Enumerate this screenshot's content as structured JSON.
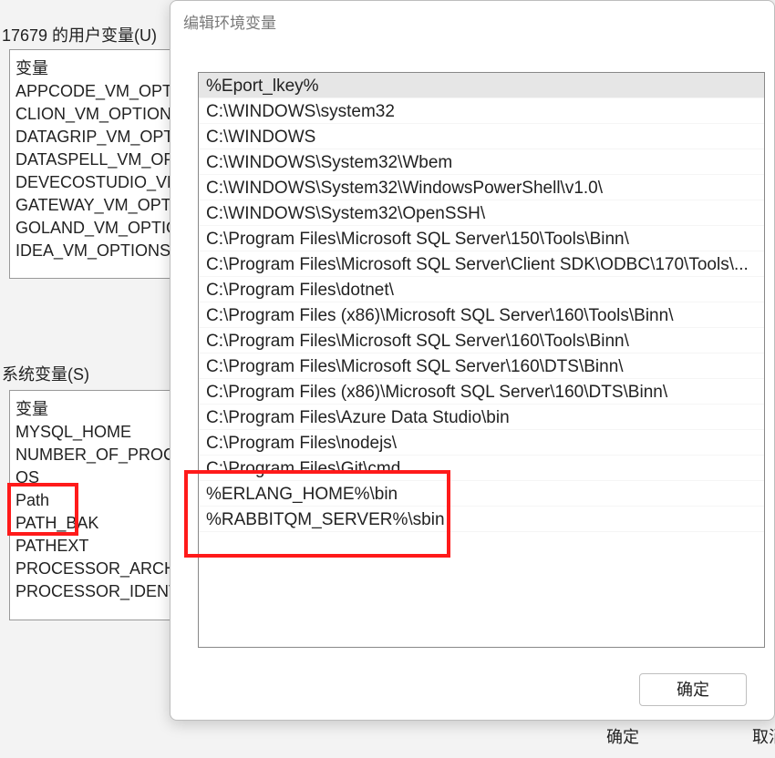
{
  "parent": {
    "user_vars_group_label": "17679 的用户变量(U)",
    "user_vars_header": "变量",
    "user_vars": [
      "APPCODE_VM_OPTIONS",
      "CLION_VM_OPTIONS",
      "DATAGRIP_VM_OPTIONS",
      "DATASPELL_VM_OPTIONS",
      "DEVECOSTUDIO_VM_OPTIONS",
      "GATEWAY_VM_OPTIONS",
      "GOLAND_VM_OPTIONS",
      "IDEA_VM_OPTIONS"
    ],
    "sys_vars_group_label": "系统变量(S)",
    "sys_vars_header": "变量",
    "sys_vars": [
      "MYSQL_HOME",
      "NUMBER_OF_PROCESSORS",
      "OS",
      "Path",
      "PATH_BAK",
      "PATHEXT",
      "PROCESSOR_ARCHITECTURE",
      "PROCESSOR_IDENTIFIER"
    ],
    "ok_label": "确定",
    "cancel_label": "取消"
  },
  "dialog": {
    "title": "编辑环境变量",
    "entries": [
      "%Eport_lkey%",
      "C:\\WINDOWS\\system32",
      "C:\\WINDOWS",
      "C:\\WINDOWS\\System32\\Wbem",
      "C:\\WINDOWS\\System32\\WindowsPowerShell\\v1.0\\",
      "C:\\WINDOWS\\System32\\OpenSSH\\",
      "C:\\Program Files\\Microsoft SQL Server\\150\\Tools\\Binn\\",
      "C:\\Program Files\\Microsoft SQL Server\\Client SDK\\ODBC\\170\\Tools\\...",
      "C:\\Program Files\\dotnet\\",
      "C:\\Program Files (x86)\\Microsoft SQL Server\\160\\Tools\\Binn\\",
      "C:\\Program Files\\Microsoft SQL Server\\160\\Tools\\Binn\\",
      "C:\\Program Files\\Microsoft SQL Server\\160\\DTS\\Binn\\",
      "C:\\Program Files (x86)\\Microsoft SQL Server\\160\\DTS\\Binn\\",
      "C:\\Program Files\\Azure Data Studio\\bin",
      "C:\\Program Files\\nodejs\\",
      "C:\\Program Files\\Git\\cmd",
      "%ERLANG_HOME%\\bin",
      "%RABBITQM_SERVER%\\sbin"
    ],
    "ok_label": "确定"
  }
}
